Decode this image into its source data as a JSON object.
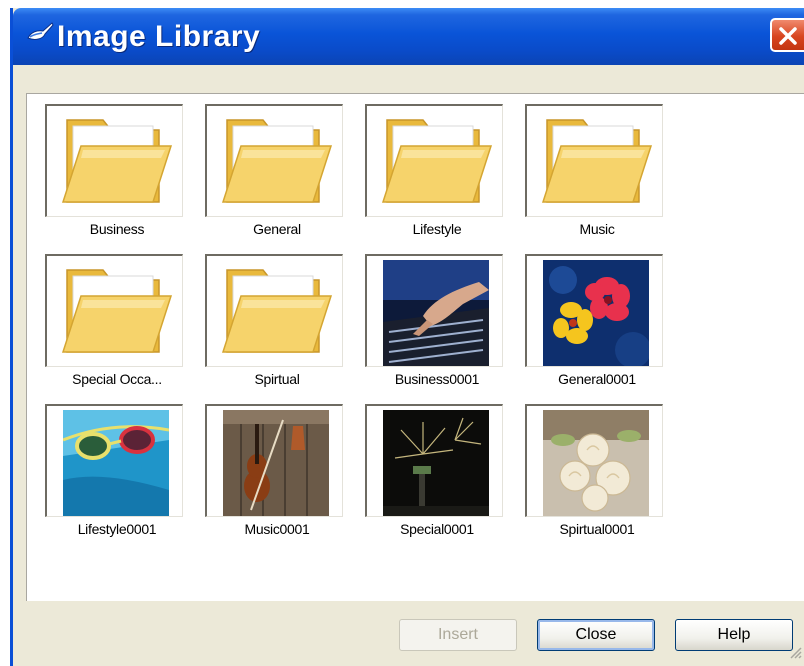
{
  "window": {
    "title": "Image Library",
    "title_icon": "paintbrush-icon",
    "close_icon": "close-x-icon"
  },
  "library": {
    "items": [
      {
        "label": "Business",
        "kind": "folder"
      },
      {
        "label": "General",
        "kind": "folder"
      },
      {
        "label": "Lifestyle",
        "kind": "folder"
      },
      {
        "label": "Music",
        "kind": "folder"
      },
      {
        "label": "Special Occa...",
        "kind": "folder"
      },
      {
        "label": "Spirtual",
        "kind": "folder"
      },
      {
        "label": "Business0001",
        "kind": "image",
        "depicts": "hand typing on keyboard"
      },
      {
        "label": "General0001",
        "kind": "image",
        "depicts": "hibiscus flowers on blue"
      },
      {
        "label": "Lifestyle0001",
        "kind": "image",
        "depicts": "swim goggles in pool"
      },
      {
        "label": "Music0001",
        "kind": "image",
        "depicts": "violin on wooden wall"
      },
      {
        "label": "Special0001",
        "kind": "image",
        "depicts": "fireworks at night"
      },
      {
        "label": "Spirtual0001",
        "kind": "image",
        "depicts": "white roses bouquet"
      }
    ]
  },
  "buttons": {
    "insert": {
      "label": "Insert",
      "enabled": false
    },
    "close": {
      "label": "Close",
      "enabled": true
    },
    "help": {
      "label": "Help",
      "enabled": true
    }
  },
  "colors": {
    "titlebar": "#0a54d8",
    "dialog_bg": "#ece9d8",
    "close_button": "#d8451f",
    "folder": "#f6d36b"
  }
}
